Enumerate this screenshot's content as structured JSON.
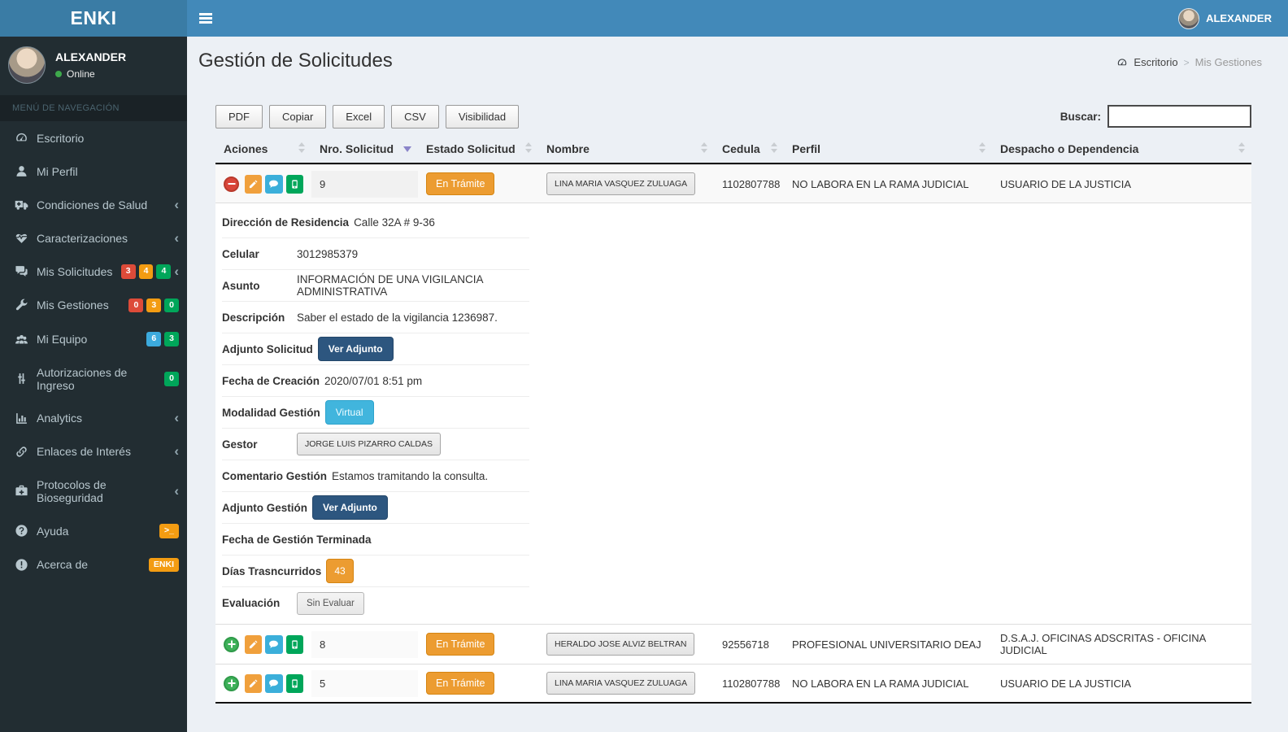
{
  "app": {
    "logo": "ENKI",
    "top_user": "ALEXANDER"
  },
  "sidebar": {
    "user": {
      "name": "ALEXANDER",
      "status": "Online"
    },
    "menu_header": "MENÚ DE NAVEGACIÓN",
    "items": [
      {
        "label": "Escritorio",
        "icon": "gauge-icon"
      },
      {
        "label": "Mi Perfil",
        "icon": "user-icon"
      },
      {
        "label": "Condiciones de Salud",
        "icon": "ambulance-icon",
        "chevron": true
      },
      {
        "label": "Caracterizaciones",
        "icon": "heartbeat-icon",
        "chevron": true
      },
      {
        "label": "Mis Solicitudes",
        "icon": "comments-icon",
        "chevron": true,
        "badges": [
          {
            "text": "3",
            "color": "#dd4b39"
          },
          {
            "text": "4",
            "color": "#f39c12"
          },
          {
            "text": "4",
            "color": "#00a65a"
          }
        ]
      },
      {
        "label": "Mis Gestiones",
        "icon": "wrench-icon",
        "badges": [
          {
            "text": "0",
            "color": "#dd4b39"
          },
          {
            "text": "3",
            "color": "#f39c12"
          },
          {
            "text": "0",
            "color": "#00a65a"
          }
        ]
      },
      {
        "label": "Mi Equipo",
        "icon": "users-icon",
        "badges": [
          {
            "text": "6",
            "color": "#3caadd"
          },
          {
            "text": "3",
            "color": "#00a65a"
          }
        ]
      },
      {
        "label": "Autorizaciones de Ingreso",
        "icon": "sliders-icon",
        "badges": [
          {
            "text": "0",
            "color": "#00a65a"
          }
        ]
      },
      {
        "label": "Analytics",
        "icon": "bar-chart-icon",
        "chevron": true
      },
      {
        "label": "Enlaces de Interés",
        "icon": "link-icon",
        "chevron": true
      },
      {
        "label": "Protocolos de Bioseguridad",
        "icon": "medkit-icon",
        "chevron": true
      },
      {
        "label": "Ayuda",
        "icon": "question-circle-icon",
        "badges": [
          {
            "text": ">_",
            "color": "#f39c12"
          }
        ]
      },
      {
        "label": "Acerca de",
        "icon": "exclamation-circle-icon",
        "badges": [
          {
            "text": "ENKI",
            "color": "#f39c12"
          }
        ]
      }
    ]
  },
  "page": {
    "title": "Gestión de Solicitudes"
  },
  "breadcrumb": {
    "home": "Escritorio",
    "current": "Mis Gestiones"
  },
  "toolbar": {
    "buttons": [
      "PDF",
      "Copiar",
      "Excel",
      "CSV",
      "Visibilidad"
    ],
    "search_label": "Buscar:",
    "search_value": ""
  },
  "table": {
    "columns": [
      "Aciones",
      "Nro. Solicitud",
      "Estado Solicitud",
      "Nombre",
      "Cedula",
      "Perfil",
      "Despacho o Dependencia"
    ],
    "sorted_column": "Nro. Solicitud",
    "sort_direction": "desc",
    "rows": [
      {
        "nro": "9",
        "estado": "En Trámite",
        "nombre": "LINA MARIA VASQUEZ ZULUAGA",
        "cedula": "1102807788",
        "perfil": "NO LABORA EN LA RAMA JUDICIAL",
        "despacho": "USUARIO DE LA JUSTICIA",
        "expanded": true
      },
      {
        "nro": "8",
        "estado": "En Trámite",
        "nombre": "HERALDO JOSE ALVIZ BELTRAN",
        "cedula": "92556718",
        "perfil": "PROFESIONAL UNIVERSITARIO DEAJ",
        "despacho": "D.S.A.J. OFICINAS ADSCRITAS - OFICINA JUDICIAL",
        "expanded": false
      },
      {
        "nro": "5",
        "estado": "En Trámite",
        "nombre": "LINA MARIA VASQUEZ ZULUAGA",
        "cedula": "1102807788",
        "perfil": "NO LABORA EN LA RAMA JUDICIAL",
        "despacho": "USUARIO DE LA JUSTICIA",
        "expanded": false
      }
    ],
    "detail": {
      "items": [
        {
          "label": "Dirección de Residencia",
          "value": "Calle 32A # 9-36"
        },
        {
          "label": "Celular",
          "value": "3012985379"
        },
        {
          "label": "Asunto",
          "value": "INFORMACIÓN DE UNA VIGILANCIA ADMINISTRATIVA"
        },
        {
          "label": "Descripción",
          "value": "Saber el estado de la vigilancia 1236987."
        },
        {
          "label": "Adjunto Solicitud",
          "value": "Ver Adjunto"
        },
        {
          "label": "Fecha de Creación",
          "value": "2020/07/01 8:51 pm"
        },
        {
          "label": "Modalidad Gestión",
          "value": "Virtual"
        },
        {
          "label": "Gestor",
          "value": "JORGE LUIS PIZARRO CALDAS"
        },
        {
          "label": "Comentario Gestión",
          "value": "Estamos tramitando la consulta."
        },
        {
          "label": "Adjunto Gestión",
          "value": "Ver Adjunto"
        },
        {
          "label": "Fecha de Gestión Terminada",
          "value": ""
        },
        {
          "label": "Días Trasncurridos",
          "value": "43"
        },
        {
          "label": "Evaluación",
          "value": "Sin Evaluar"
        }
      ]
    }
  },
  "colors": {
    "navbar": "#4289b9",
    "logo_bg": "#3a7ca5",
    "sidebar_bg": "#222d32",
    "content_bg": "#ecf0f5",
    "status_en_tramite": "#ec9c31",
    "btn_dark_blue": "#2d567f",
    "badge_virtual": "#41b5dd",
    "badge_red": "#dd4b39",
    "badge_orange": "#f39c12",
    "badge_green": "#00a65a",
    "badge_aqua": "#3caadd",
    "online_dot": "#3ea94c"
  }
}
